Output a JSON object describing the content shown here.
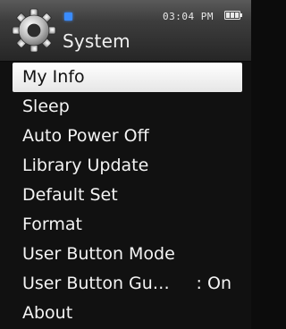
{
  "header": {
    "title": "System",
    "time": "03:04 PM",
    "icon": "gear-icon",
    "indicator_color": "#3a8cff",
    "battery_icon": "battery-icon"
  },
  "menu": {
    "items": [
      {
        "label": "My Info",
        "selected": true
      },
      {
        "label": "Sleep"
      },
      {
        "label": "Auto Power Off"
      },
      {
        "label": "Library Update"
      },
      {
        "label": "Default Set"
      },
      {
        "label": "Format"
      },
      {
        "label": "User Button Mode"
      },
      {
        "label": "User Button Gu…",
        "value": ": On"
      },
      {
        "label": "About"
      }
    ]
  },
  "colors": {
    "background": "#111111",
    "selected_background": "#ffffff",
    "text": "#f4f4f4",
    "selected_text": "#111111"
  }
}
